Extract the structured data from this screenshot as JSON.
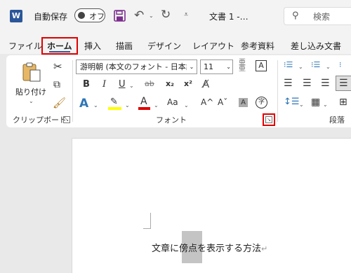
{
  "titlebar": {
    "app_logo": "W",
    "autosave_label": "自動保存",
    "autosave_state": "オフ",
    "doc_title": "文書 1  -…",
    "search_placeholder": "検索",
    "icons": [
      "word-logo-icon",
      "save-icon",
      "undo-icon",
      "redo-icon",
      "customize-qat-icon",
      "search-icon"
    ]
  },
  "tabs": [
    "ファイル",
    "ホーム",
    "挿入",
    "描画",
    "デザイン",
    "レイアウト",
    "参考資料",
    "差し込み文書"
  ],
  "active_tab": "ホーム",
  "ribbon": {
    "clipboard": {
      "paste_label": "貼り付け",
      "group_label": "クリップボード"
    },
    "font": {
      "font_name": "游明朝 (本文のフォント - 日本語)",
      "font_size": "11",
      "bold": "B",
      "italic": "I",
      "underline": "U",
      "strike": "ab",
      "subscript": "x₂",
      "superscript": "x²",
      "text_effects": "A",
      "font_color": "A",
      "case": "Aa",
      "grow": "A^",
      "shrink": "Aˇ",
      "char_shading": "A",
      "enclose": "字",
      "group_label": "フォント"
    },
    "paragraph": {
      "group_label": "段落"
    }
  },
  "document": {
    "before": "文章に",
    "selected": "傍点",
    "after": "を表示する方法",
    "para_mark": "↵"
  },
  "colors": {
    "word_blue": "#2b579a",
    "highlight_red": "#e00000",
    "font_color_red": "#e00000",
    "highlighter_yellow": "#ffff00",
    "selection_gray": "#c4c4c4"
  }
}
